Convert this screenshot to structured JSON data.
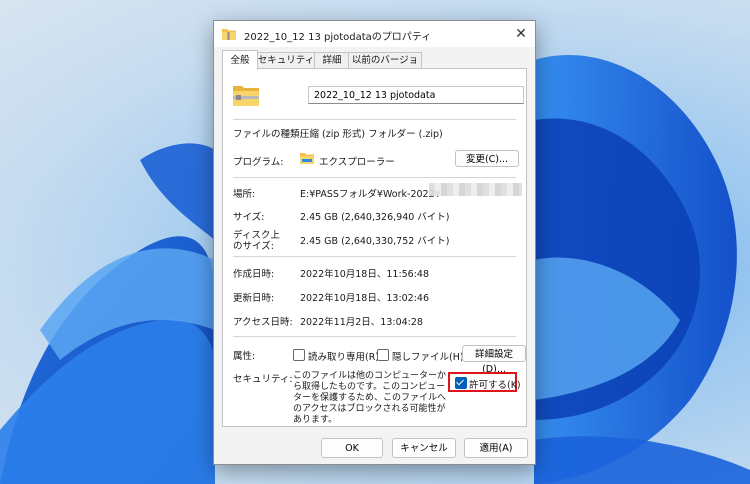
{
  "dialog": {
    "title": "2022_10_12 13 pjotodataのプロパティ",
    "close_symbol": "✕",
    "tabs": [
      {
        "label": "全般",
        "active": true
      },
      {
        "label": "セキュリティ",
        "active": false
      },
      {
        "label": "詳細",
        "active": false
      },
      {
        "label": "以前のバージョン",
        "active": false
      }
    ]
  },
  "general": {
    "file_name": "2022_10_12 13 pjotodata",
    "type_label": "ファイルの種類:",
    "type_value": "圧縮 (zip 形式) フォルダー (.zip)",
    "program_label": "プログラム:",
    "program_value": "エクスプローラー",
    "change_button": "変更(C)...",
    "location_label": "場所:",
    "location_value": "E:¥PASSフォルダ¥Work-2022¥",
    "size_label": "サイズ:",
    "size_value": "2.45 GB (2,640,326,940 バイト)",
    "disk_size_label_1": "ディスク上",
    "disk_size_label_2": "のサイズ:",
    "disk_size_value": "2.45 GB (2,640,330,752 バイト)",
    "created_label": "作成日時:",
    "created_value": "2022年10月18日、11:56:48",
    "modified_label": "更新日時:",
    "modified_value": "2022年10月18日、13:02:46",
    "accessed_label": "アクセス日時:",
    "accessed_value": "2022年11月2日、13:04:28",
    "attributes_label": "属性:",
    "readonly_label": "読み取り専用(R)",
    "hidden_label": "隠しファイル(H)",
    "advanced_button": "詳細設定(D)...",
    "security_label": "セキュリティ:",
    "security_text": "このファイルは他のコンピューターから取得したものです。このコンピューターを保護するため、このファイルへのアクセスはブロックされる可能性があります。",
    "unblock_label": "許可する(K)",
    "unblock_checked": true
  },
  "footer": {
    "ok": "OK",
    "cancel": "キャンセル",
    "apply": "適用(A)"
  },
  "colors": {
    "accent": "#005fb8",
    "highlight": "#e0151b"
  }
}
